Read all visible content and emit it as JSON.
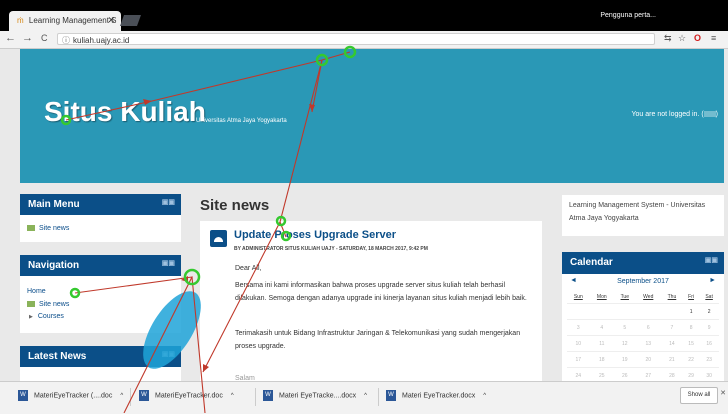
{
  "browser": {
    "tab_title": "Learning Management S",
    "tab_close": "✕",
    "user_name": "Pengguna perta...",
    "back": "←",
    "forward": "→",
    "reload": "C",
    "url": "kuliah.uajy.ac.id",
    "info_icon": "ⓘ",
    "translate_icon": "⇆",
    "star_icon": "☆",
    "opera_icon": "O",
    "menu_icon": "≡"
  },
  "site": {
    "title": "Situs Kuliah",
    "subtitle": "Universitas Atma Jaya Yogyakarta",
    "login_status": "You are not logged in. ("
  },
  "main_menu": {
    "title": "Main Menu",
    "items": [
      {
        "label": "Site news"
      }
    ]
  },
  "navigation": {
    "title": "Navigation",
    "home": "Home",
    "site_news": "Site news",
    "courses": "Courses"
  },
  "latest_news": {
    "title": "Latest News"
  },
  "site_news": {
    "heading": "Site news",
    "post": {
      "title": "Update Proses Upgrade Server",
      "byline": "BY ADMINISTRATOR SITUS KULIAH UAJY - SATURDAY, 18 MARCH 2017, 9:42 PM",
      "greeting": "Dear All,",
      "para1": "Bersama ini kami informasikan bahwa proses upgrade server situs kuliah telah berhasil dilakukan. Semoga dengan adanya upgrade ini kinerja layanan situs kuliah menjadi lebih baik.",
      "para2": "Terimakasih untuk Bidang Infrastruktur Jaringan & Telekomunikasi yang sudah mengerjakan proses upgrade.",
      "trailing": "Salam"
    }
  },
  "right_info": "Learning Management System - Universitas Atma Jaya Yogyakarta",
  "calendar": {
    "title": "Calendar",
    "month": "September 2017",
    "prev": "◄",
    "next": "►",
    "days": [
      "Sun",
      "Mon",
      "Tue",
      "Wed",
      "Thu",
      "Fri",
      "Sat"
    ],
    "weeks": [
      [
        "",
        "",
        "",
        "",
        "",
        "1",
        "2"
      ],
      [
        "3",
        "4",
        "5",
        "6",
        "7",
        "8",
        "9"
      ],
      [
        "10",
        "11",
        "12",
        "13",
        "14",
        "15",
        "16"
      ],
      [
        "17",
        "18",
        "19",
        "20",
        "21",
        "22",
        "23"
      ],
      [
        "24",
        "25",
        "26",
        "27",
        "28",
        "29",
        "30"
      ]
    ]
  },
  "downloads": {
    "items": [
      {
        "name": "MateriEyeTracker (....doc"
      },
      {
        "name": "MateriEyeTracker.doc"
      },
      {
        "name": "Materi EyeTracke....docx"
      },
      {
        "name": "Materi EyeTracker.docx"
      }
    ],
    "show_all": "Show all",
    "close": "✕"
  },
  "colors": {
    "banner": "#2a98b6",
    "block_header": "#0b4f88",
    "gaze_path": "#c0392b",
    "fixation": "#35c92f",
    "heat_blob": "#1fa3d8"
  }
}
